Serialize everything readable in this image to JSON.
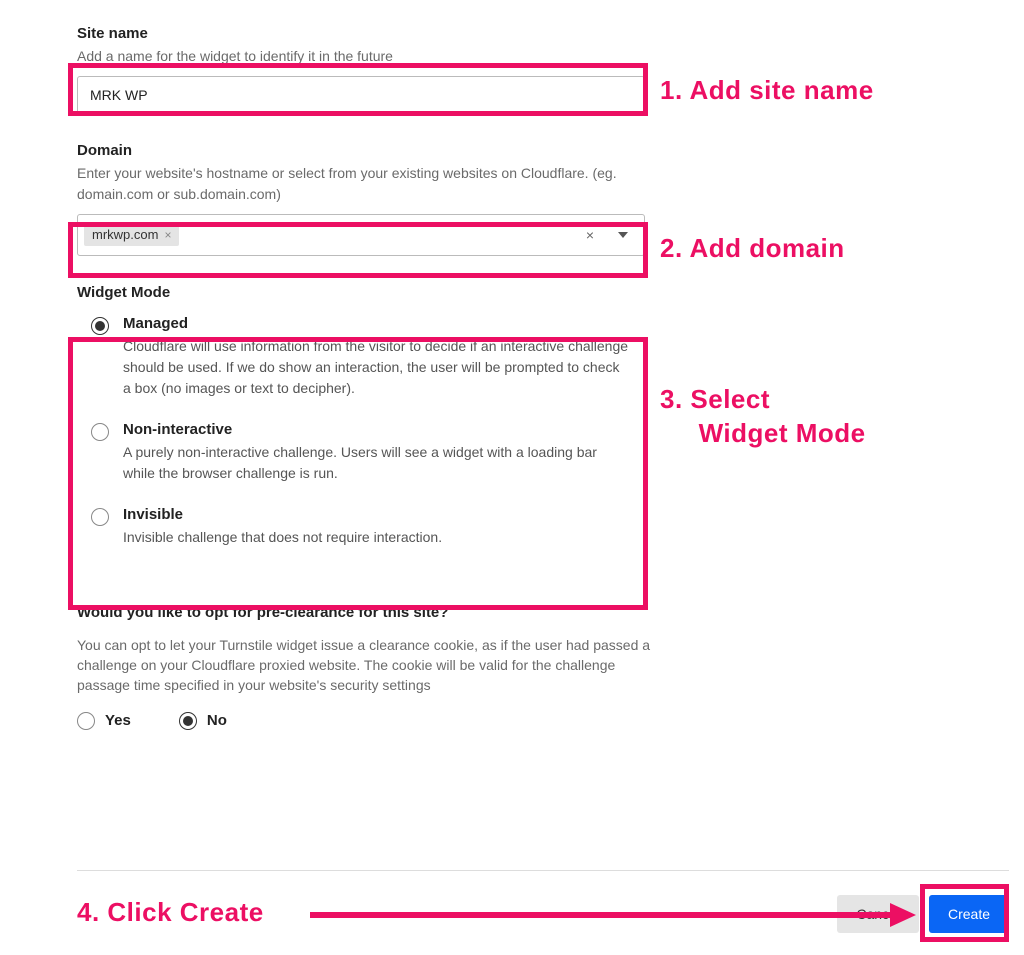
{
  "siteName": {
    "label": "Site name",
    "help": "Add a name for the widget to identify it in the future",
    "value": "MRK WP"
  },
  "domain": {
    "label": "Domain",
    "help": "Enter your website's hostname or select from your existing websites on Cloudflare. (eg. domain.com or sub.domain.com)",
    "chip": "mrkwp.com"
  },
  "widgetMode": {
    "label": "Widget Mode",
    "options": [
      {
        "title": "Managed",
        "desc": "Cloudflare will use information from the visitor to decide if an interactive challenge should be used. If we do show an interaction, the user will be prompted to check a box (no images or text to decipher).",
        "selected": true
      },
      {
        "title": "Non-interactive",
        "desc": "A purely non-interactive challenge. Users will see a widget with a loading bar while the browser challenge is run.",
        "selected": false
      },
      {
        "title": "Invisible",
        "desc": "Invisible challenge that does not require interaction.",
        "selected": false
      }
    ]
  },
  "preclearance": {
    "label": "Would you like to opt for pre-clearance for this site?",
    "help": "You can opt to let your Turnstile widget issue a clearance cookie, as if the user had passed a challenge on your Cloudflare proxied website. The cookie will be valid for the challenge passage time specified in your website's security settings",
    "yesLabel": "Yes",
    "noLabel": "No",
    "selected": "no"
  },
  "buttons": {
    "cancel": "Cancel",
    "create": "Create"
  },
  "annotations": {
    "step1": "1. Add site name",
    "step2": "2. Add domain",
    "step3": "3. Select\n     Widget Mode",
    "step4": "4. Click Create"
  }
}
